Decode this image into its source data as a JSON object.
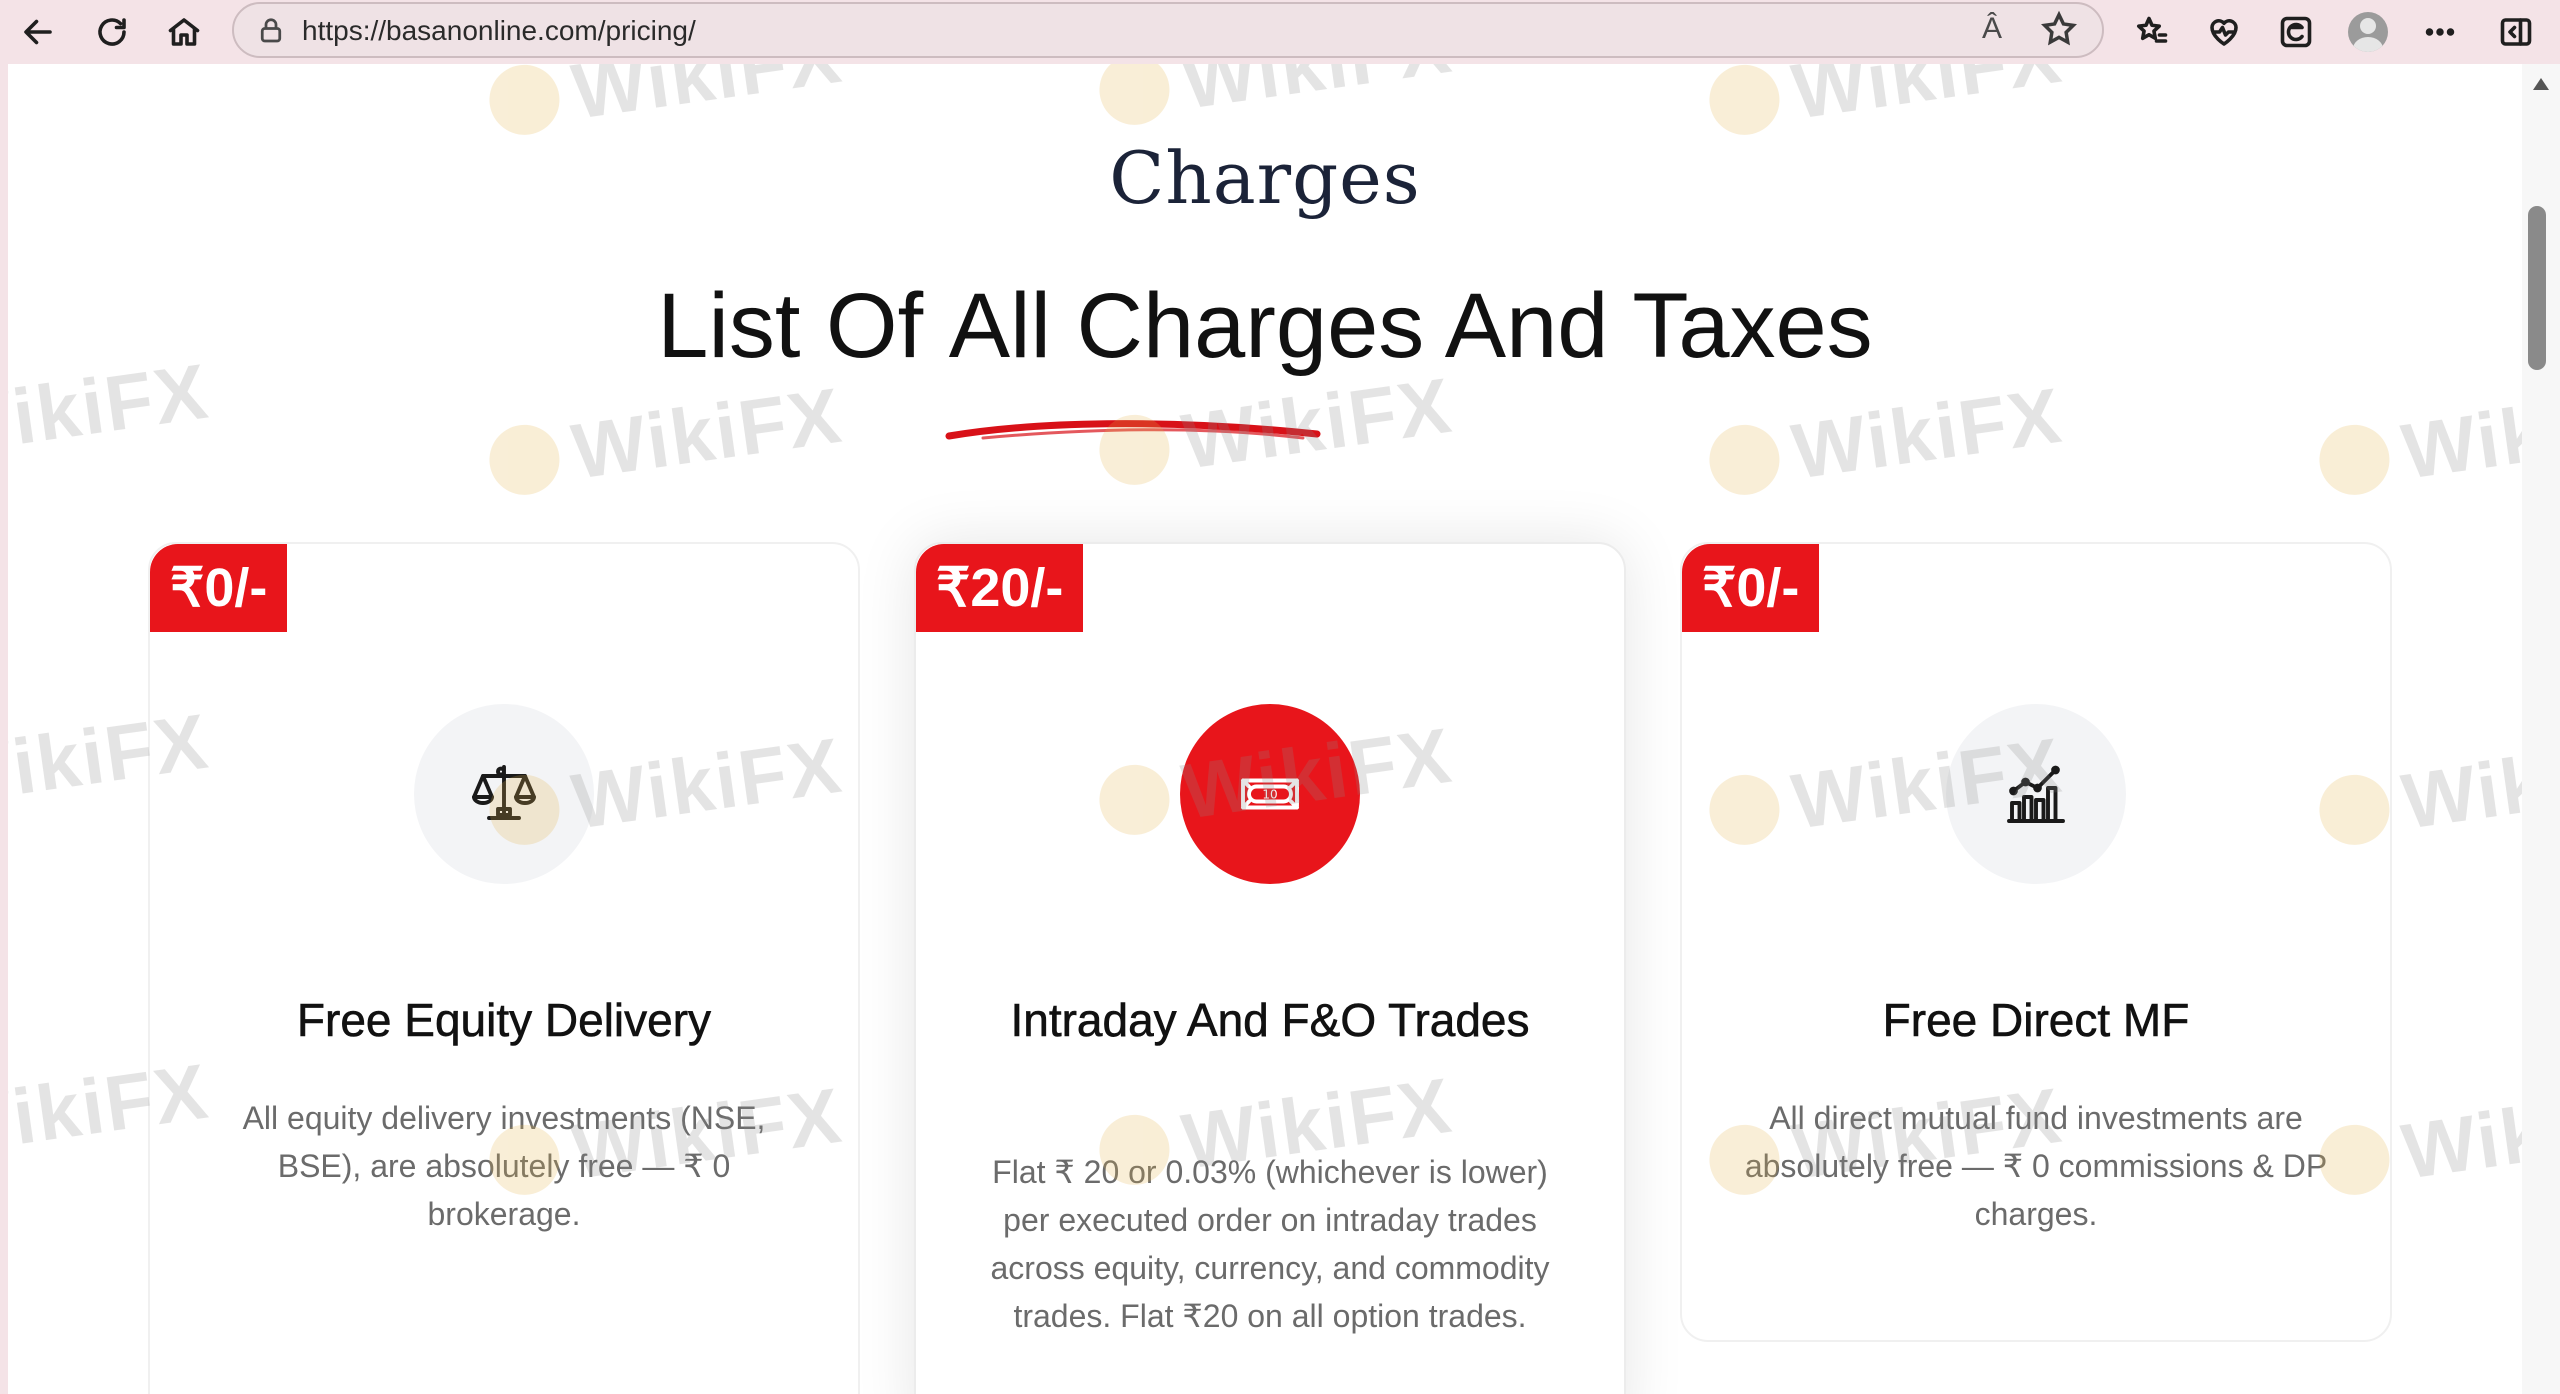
{
  "browser": {
    "url": "https://basanonline.com/pricing/",
    "read_aloud_label": "Â"
  },
  "page": {
    "kicker": "Charges",
    "headline_pre": "List Of ",
    "headline_highlight": "All Charges",
    "headline_post": " And Taxes"
  },
  "cards": [
    {
      "price": "₹0/-",
      "icon": "scales-icon",
      "title": "Free Equity Delivery",
      "description": "All equity delivery investments (NSE, BSE), are absolutely free — ₹ 0 brokerage."
    },
    {
      "price": "₹20/-",
      "icon": "banknote-icon",
      "title": "Intraday And F&O Trades",
      "description": "Flat ₹ 20 or 0.03% (whichever is lower) per executed order on intraday trades across equity, currency, and commodity trades. Flat ₹20 on all option trades."
    },
    {
      "price": "₹0/-",
      "icon": "growth-chart-icon",
      "title": "Free Direct MF",
      "description": "All direct mutual fund investments are absolutely free — ₹ 0 commissions & DP charges."
    }
  ],
  "watermark": {
    "text": "WikiFX"
  },
  "colors": {
    "accent": "#e8151b",
    "chrome_bg": "#f4e3e7",
    "heading": "#111111",
    "kicker": "#1b2338",
    "body_text": "#6b6b6b"
  }
}
